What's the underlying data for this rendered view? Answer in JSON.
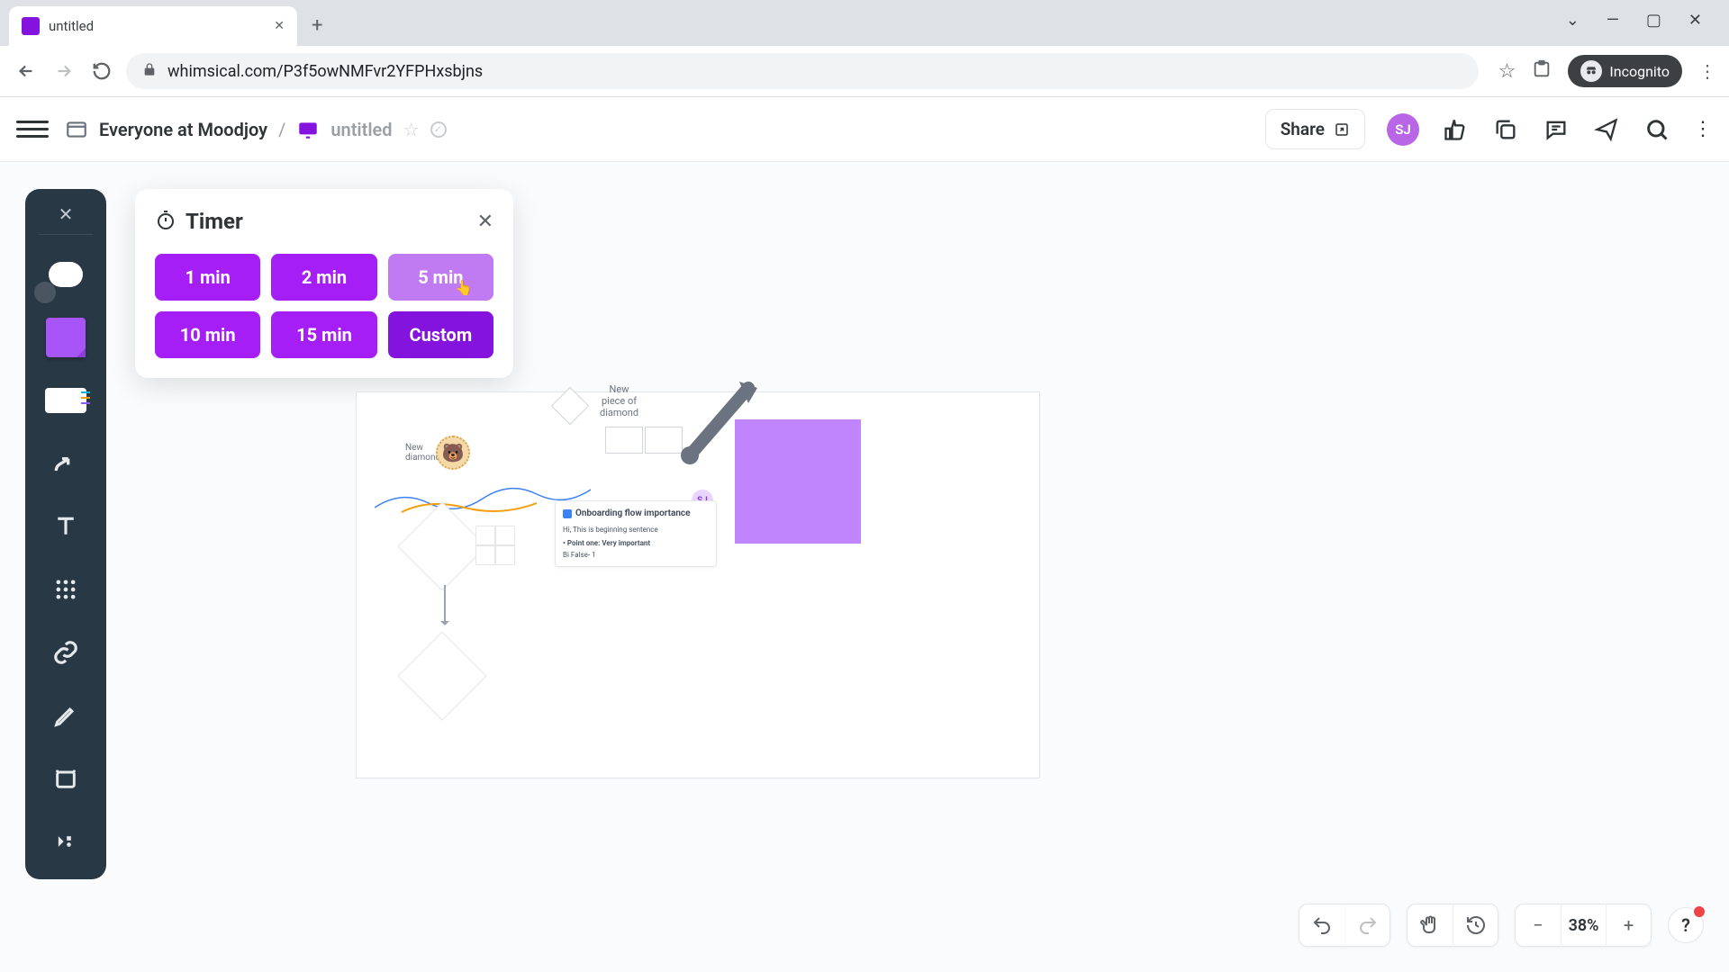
{
  "browser": {
    "tab_title": "untitled",
    "url": "whimsical.com/P3f5owNMFvr2YFPHxsbjns",
    "incognito_label": "Incognito"
  },
  "header": {
    "team": "Everyone at Moodjoy",
    "doc_title": "untitled",
    "share_label": "Share",
    "avatar_initials": "SJ"
  },
  "timer": {
    "title": "Timer",
    "options": [
      "1 min",
      "2 min",
      "5 min",
      "10 min",
      "15 min",
      "Custom"
    ]
  },
  "canvas": {
    "diamond_label": "New\npiece of\ndiamond",
    "bear_label": "New\ndiamond",
    "sj_badge": "SJ",
    "card": {
      "title": "Onboarding flow importance",
      "line1": "Hi, This is beginning sentence",
      "bullet": "• Point one: Very important",
      "line2": "Bi False- 1"
    }
  },
  "bottom": {
    "zoom": "38%"
  }
}
